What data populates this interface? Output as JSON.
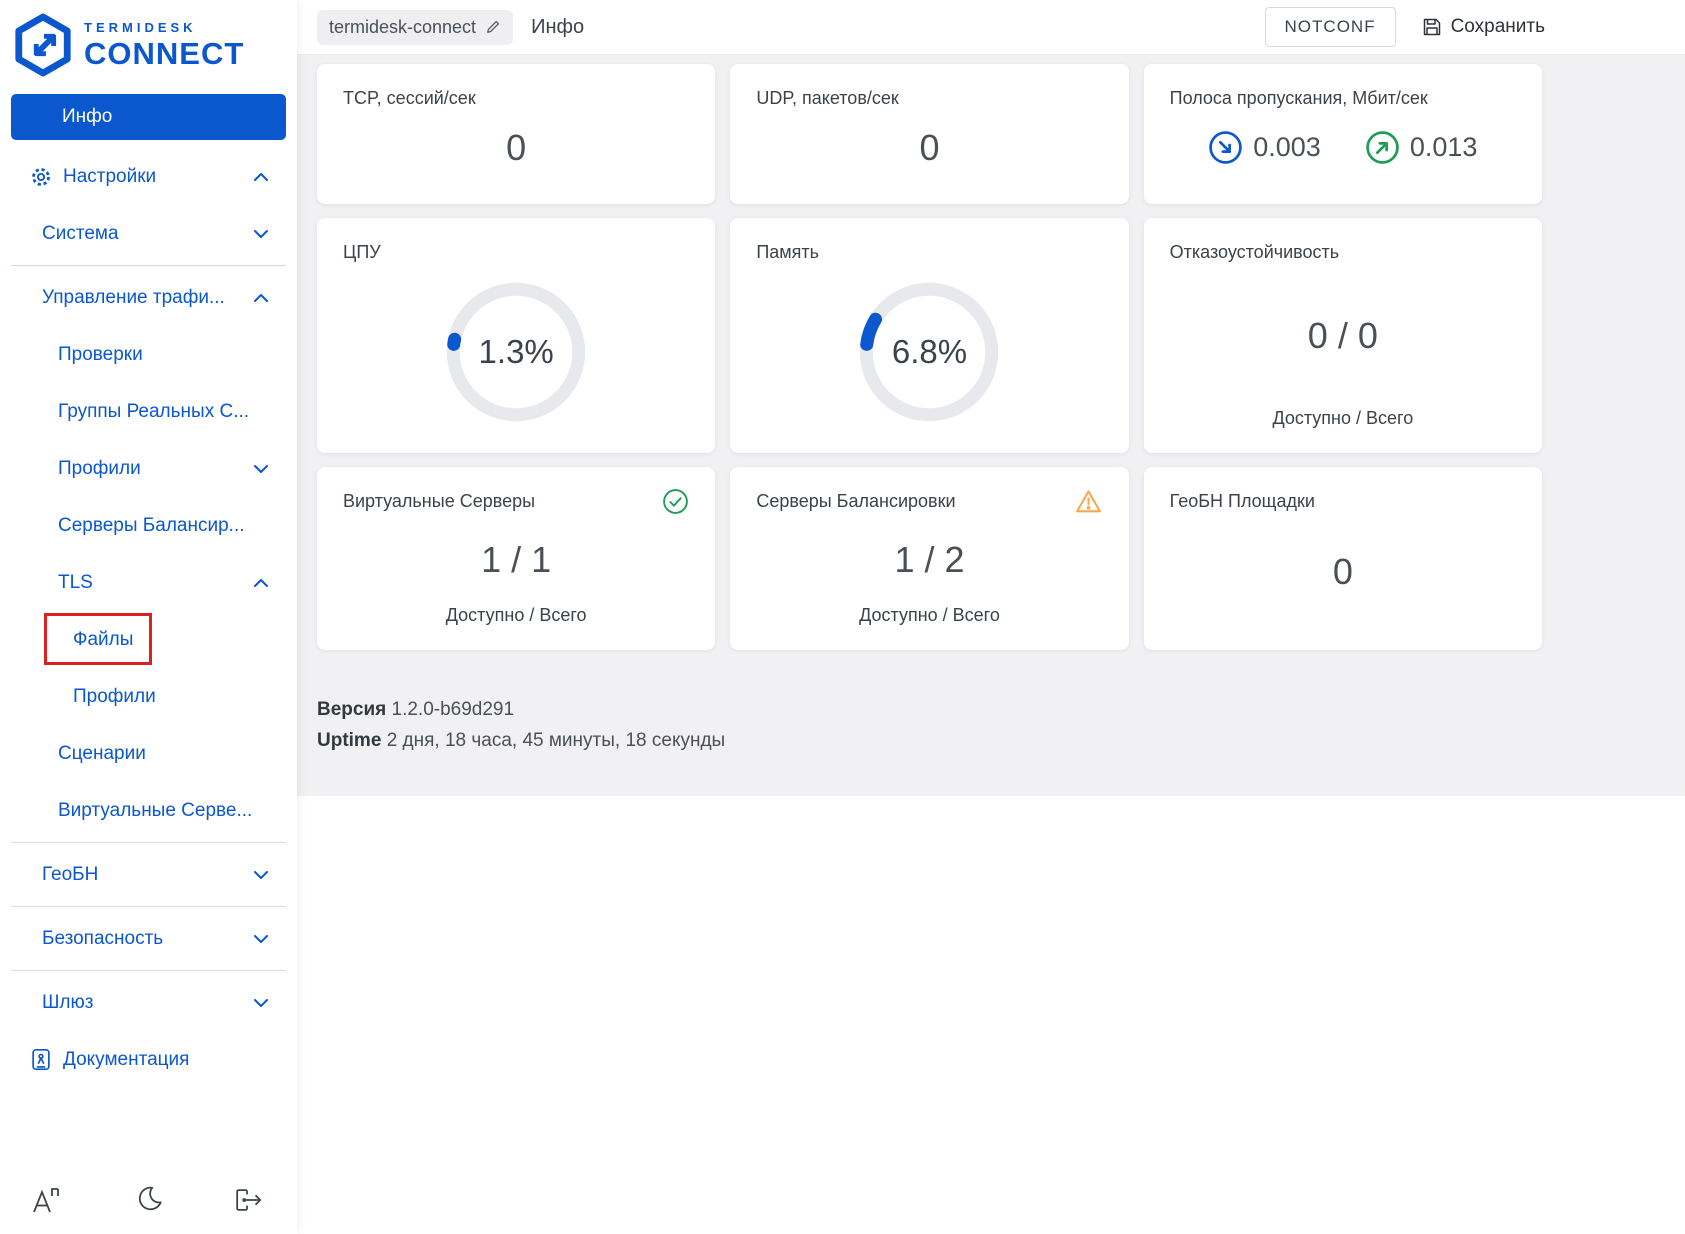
{
  "brand": {
    "name_top": "TERMIDESK",
    "name_bottom": "CONNECT"
  },
  "colors": {
    "accent_blue": "#0B57CE",
    "success_green": "#1D9C55",
    "warning_orange": "#F5A94B",
    "highlight_red": "#DC1F1F",
    "content_bg": "#F1F1F3"
  },
  "sidebar": {
    "home": "Инфо",
    "items": [
      {
        "label": "Настройки",
        "chevron": "up"
      },
      {
        "label": "Система",
        "chevron": "down"
      },
      {
        "label": "Управление трафи...",
        "chevron": "up"
      },
      {
        "label": "Проверки",
        "chevron": ""
      },
      {
        "label": "Группы Реальных С...",
        "chevron": ""
      },
      {
        "label": "Профили",
        "chevron": "down"
      },
      {
        "label": "Серверы Балансир...",
        "chevron": ""
      },
      {
        "label": "TLS",
        "chevron": "up"
      },
      {
        "label": "Файлы",
        "chevron": "",
        "highlighted": true
      },
      {
        "label": "Профили",
        "chevron": ""
      },
      {
        "label": "Сценарии",
        "chevron": ""
      },
      {
        "label": "Виртуальные Серве...",
        "chevron": ""
      },
      {
        "label": "ГеоБН",
        "chevron": "down"
      },
      {
        "label": "Безопасность",
        "chevron": "down"
      },
      {
        "label": "Шлюз",
        "chevron": "down"
      },
      {
        "label": "Документация",
        "chevron": ""
      }
    ],
    "footer_icons": [
      "language-icon",
      "moon-icon",
      "logout-icon"
    ]
  },
  "header": {
    "hostname_chip": "termidesk-connect",
    "title": "Инфо",
    "status_badge": "NOTCONF",
    "save_label": "Сохранить"
  },
  "cards": [
    {
      "title": "TCP, сессий/сек",
      "value": "0"
    },
    {
      "title": "UDP, пакетов/сек",
      "value": "0"
    },
    {
      "title": "Полоса пропускания, Мбит/сек",
      "down": "0.003",
      "up": "0.013"
    },
    {
      "title": "ЦПУ",
      "percent_text": "1.3%",
      "percent_value": 1.3
    },
    {
      "title": "Память",
      "percent_text": "6.8%",
      "percent_value": 6.8
    },
    {
      "title": "Отказоустойчивость",
      "value": "0 / 0",
      "caption": "Доступно / Всего"
    },
    {
      "title": "Виртуальные Серверы",
      "value": "1 / 1",
      "caption": "Доступно / Всего",
      "status": "ok"
    },
    {
      "title": "Серверы Балансировки",
      "value": "1 / 2",
      "caption": "Доступно / Всего",
      "status": "warning"
    },
    {
      "title": "ГеоБН Площадки",
      "value": "0"
    }
  ],
  "meta": {
    "version_label": "Версия",
    "version": "1.2.0-b69d291",
    "uptime_label": "Uptime",
    "uptime": "2 дня, 18 часа, 45 минуты, 18 секунды"
  },
  "icons": {
    "edit": "pencil-icon",
    "save": "floppy-icon",
    "settings": "gear-icon",
    "docs": "book-icon",
    "ok": "check-circle-icon",
    "warning": "warning-triangle-icon",
    "inbound": "arrow-down-right-circle-icon",
    "outbound": "arrow-up-right-circle-icon"
  }
}
